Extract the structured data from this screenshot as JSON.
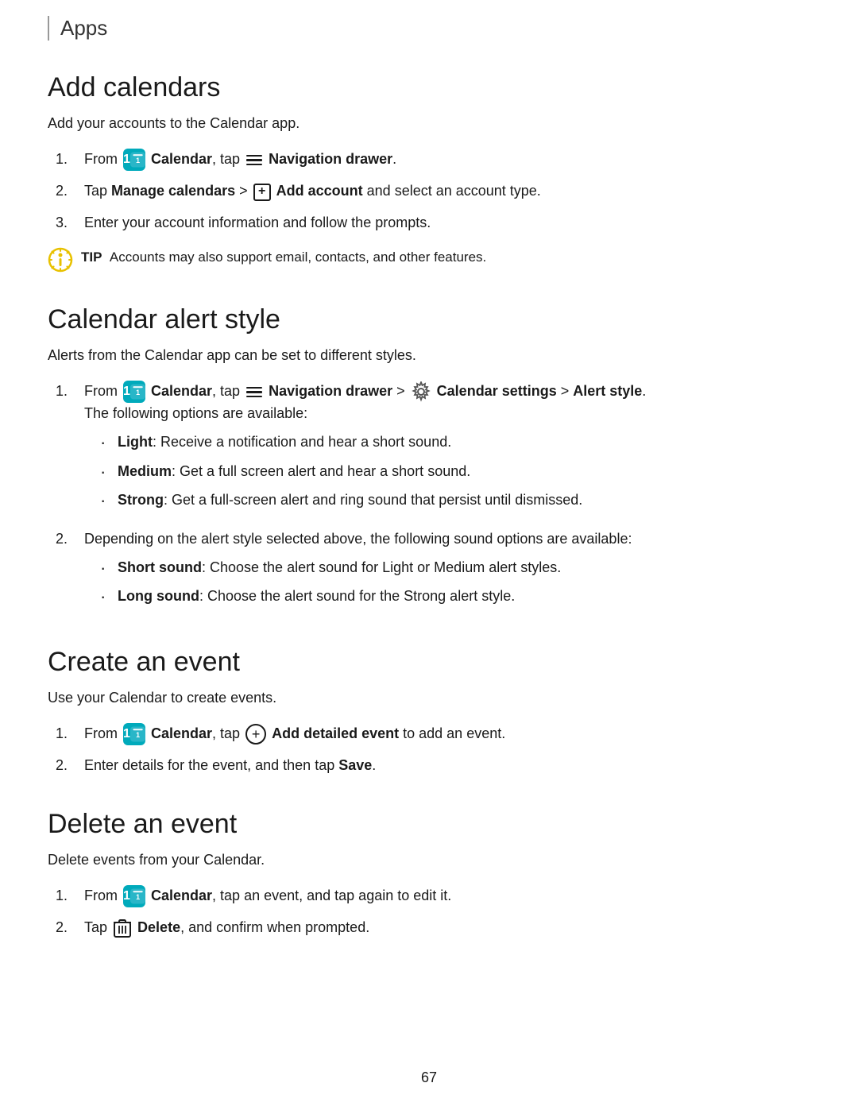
{
  "header": {
    "title": "Apps"
  },
  "sections": [
    {
      "id": "add-calendars",
      "title": "Add calendars",
      "description": "Add your accounts to the Calendar app.",
      "steps": [
        {
          "number": "1.",
          "content": "From [calendar] Calendar, tap [nav] Navigation drawer."
        },
        {
          "number": "2.",
          "content": "Tap [bold]Manage calendars[/bold] > [plus] [bold]Add account[/bold] and select an account type."
        },
        {
          "number": "3.",
          "content": "Enter your account information and follow the prompts."
        }
      ],
      "tip": {
        "label": "TIP",
        "text": "Accounts may also support email, contacts, and other features."
      }
    },
    {
      "id": "calendar-alert-style",
      "title": "Calendar alert style",
      "description": "Alerts from the Calendar app can be set to different styles.",
      "steps": [
        {
          "number": "1.",
          "sub_intro": "From [calendar] Calendar, tap [nav] Navigation drawer > [gear] Calendar settings > Alert style.",
          "sub_note": "The following options are available:",
          "bullets": [
            {
              "label": "Light",
              "text": "Receive a notification and hear a short sound."
            },
            {
              "label": "Medium",
              "text": "Get a full screen alert and hear a short sound."
            },
            {
              "label": "Strong",
              "text": "Get a full-screen alert and ring sound that persist until dismissed."
            }
          ]
        },
        {
          "number": "2.",
          "content": "Depending on the alert style selected above, the following sound options are available:",
          "bullets": [
            {
              "label": "Short sound",
              "text": "Choose the alert sound for Light or Medium alert styles."
            },
            {
              "label": "Long sound",
              "text": "Choose the alert sound for the Strong alert style."
            }
          ]
        }
      ]
    },
    {
      "id": "create-an-event",
      "title": "Create an event",
      "description": "Use your Calendar to create events.",
      "steps": [
        {
          "number": "1.",
          "content": "From [calendar] Calendar, tap [plus-circle] Add detailed event to add an event."
        },
        {
          "number": "2.",
          "content": "Enter details for the event, and then tap [bold]Save[/bold]."
        }
      ]
    },
    {
      "id": "delete-an-event",
      "title": "Delete an event",
      "description": "Delete events from your Calendar.",
      "steps": [
        {
          "number": "1.",
          "content": "From [calendar] Calendar, tap an event, and tap again to edit it."
        },
        {
          "number": "2.",
          "content": "Tap [trash] [bold]Delete[/bold], and confirm when prompted."
        }
      ]
    }
  ],
  "footer": {
    "page_number": "67"
  },
  "labels": {
    "from": "From",
    "tap": "Tap",
    "calendar_text": "Calendar",
    "nav_drawer": "Navigation drawer",
    "manage_calendars": "Manage calendars",
    "add_account": "Add account",
    "calendar_settings": "Calendar settings",
    "alert_style": "Alert style",
    "add_detailed_event": "Add detailed event",
    "save": "Save",
    "delete": "Delete",
    "tip": "TIP"
  }
}
